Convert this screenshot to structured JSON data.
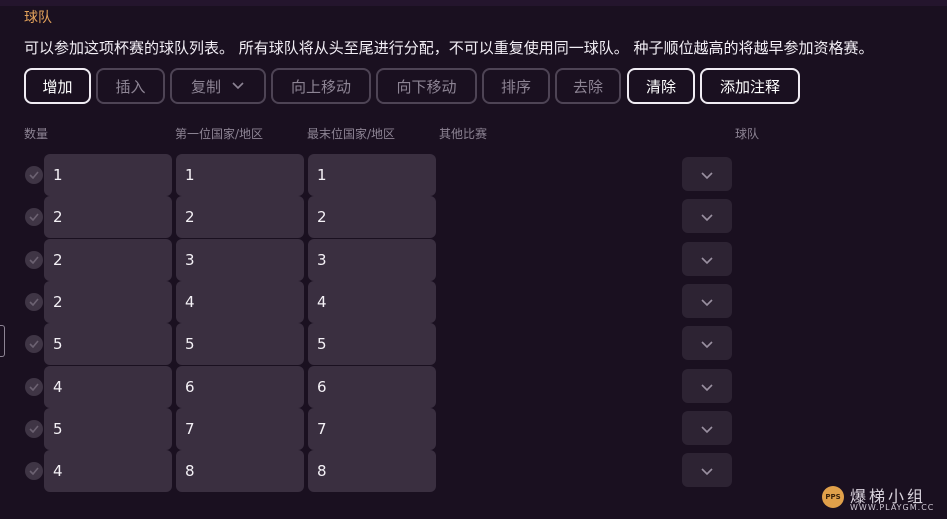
{
  "section": {
    "title": "球队"
  },
  "description": "可以参加这项杯赛的球队列表。 所有球队将从头至尾进行分配，不可以重复使用同一球队。 种子顺位越高的将越早参加资格赛。",
  "toolbar": {
    "add": "增加",
    "insert": "插入",
    "copy": "复制",
    "move_up": "向上移动",
    "move_down": "向下移动",
    "sort": "排序",
    "remove": "去除",
    "clear": "清除",
    "add_note": "添加注释"
  },
  "columns": {
    "quantity": "数量",
    "first_nation": "第一位国家/地区",
    "last_nation": "最末位国家/地区",
    "other_competition": "其他比赛",
    "team": "球队"
  },
  "rows": [
    {
      "quantity": "1",
      "first": "1",
      "last": "1"
    },
    {
      "quantity": "2",
      "first": "2",
      "last": "2"
    },
    {
      "quantity": "2",
      "first": "3",
      "last": "3"
    },
    {
      "quantity": "2",
      "first": "4",
      "last": "4"
    },
    {
      "quantity": "5",
      "first": "5",
      "last": "5"
    },
    {
      "quantity": "4",
      "first": "6",
      "last": "6"
    },
    {
      "quantity": "5",
      "first": "7",
      "last": "7"
    },
    {
      "quantity": "4",
      "first": "8",
      "last": "8"
    }
  ],
  "watermark": {
    "logo_text": "PPS",
    "name": "爆梯小组",
    "url": "WWW.PLAYGM.CC"
  },
  "colors": {
    "background": "#1a1020",
    "accent_title": "#e3a25b",
    "cell": "#3a2f40",
    "dropdown": "#2d2333"
  }
}
